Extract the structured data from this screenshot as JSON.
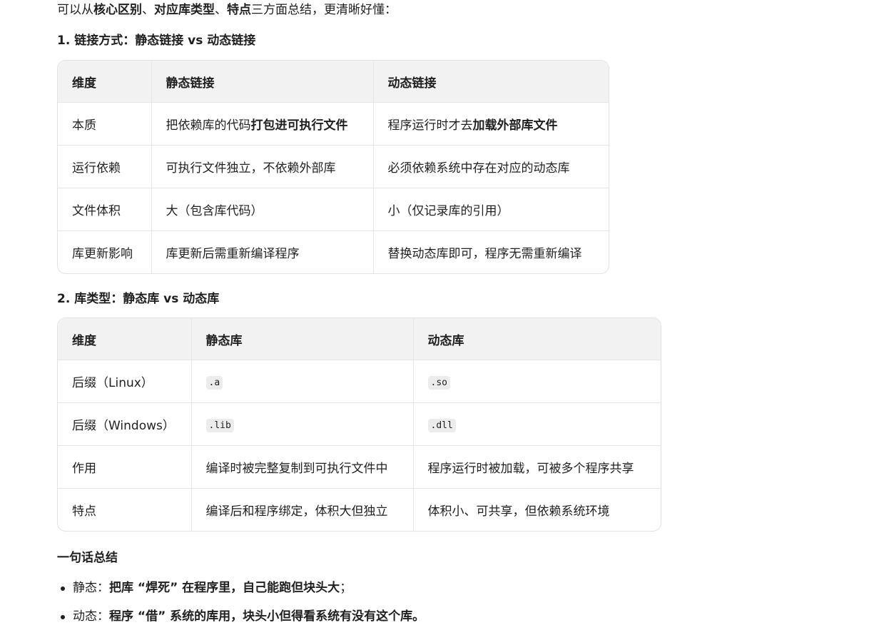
{
  "intro": {
    "prefix": "可以从",
    "bold1": "核心区别",
    "sep1": "、",
    "bold2": "对应库类型",
    "sep2": "、",
    "bold3": "特点",
    "suffix": "三方面总结，更清晰好懂："
  },
  "section1": {
    "heading": "1. 链接方式：静态链接 vs 动态链接",
    "headers": [
      "维度",
      "静态链接",
      "动态链接"
    ],
    "rows": [
      {
        "dim": "本质",
        "static_prefix": "把依赖库的代码",
        "static_bold": "打包进可执行文件",
        "dynamic_prefix": "程序运行时才去",
        "dynamic_bold": "加载外部库文件"
      },
      {
        "dim": "运行依赖",
        "static": "可执行文件独立，不依赖外部库",
        "dynamic": "必须依赖系统中存在对应的动态库"
      },
      {
        "dim": "文件体积",
        "static": "大（包含库代码）",
        "dynamic": "小（仅记录库的引用）"
      },
      {
        "dim": "库更新影响",
        "static": "库更新后需重新编译程序",
        "dynamic": "替换动态库即可，程序无需重新编译"
      }
    ]
  },
  "section2": {
    "heading": "2. 库类型：静态库 vs 动态库",
    "headers": [
      "维度",
      "静态库",
      "动态库"
    ],
    "rows": [
      {
        "dim": "后缀（Linux）",
        "static": ".a",
        "dynamic": ".so"
      },
      {
        "dim": "后缀（Windows）",
        "static": ".lib",
        "dynamic": ".dll"
      },
      {
        "dim": "作用",
        "static": "编译时被完整复制到可执行文件中",
        "dynamic": "程序运行时被加载，可被多个程序共享"
      },
      {
        "dim": "特点",
        "static": "编译后和程序绑定，体积大但独立",
        "dynamic": "体积小、可共享，但依赖系统环境"
      }
    ]
  },
  "summary": {
    "heading": "一句话总结",
    "items": [
      {
        "label": "静态：",
        "bold": "把库 “焊死” 在程序里，自己能跑但块头大",
        "tail": "；"
      },
      {
        "label": "动态：",
        "bold": "程序 “借” 系统的库用，块头小但得看系统有没有这个库。",
        "tail": ""
      }
    ]
  }
}
